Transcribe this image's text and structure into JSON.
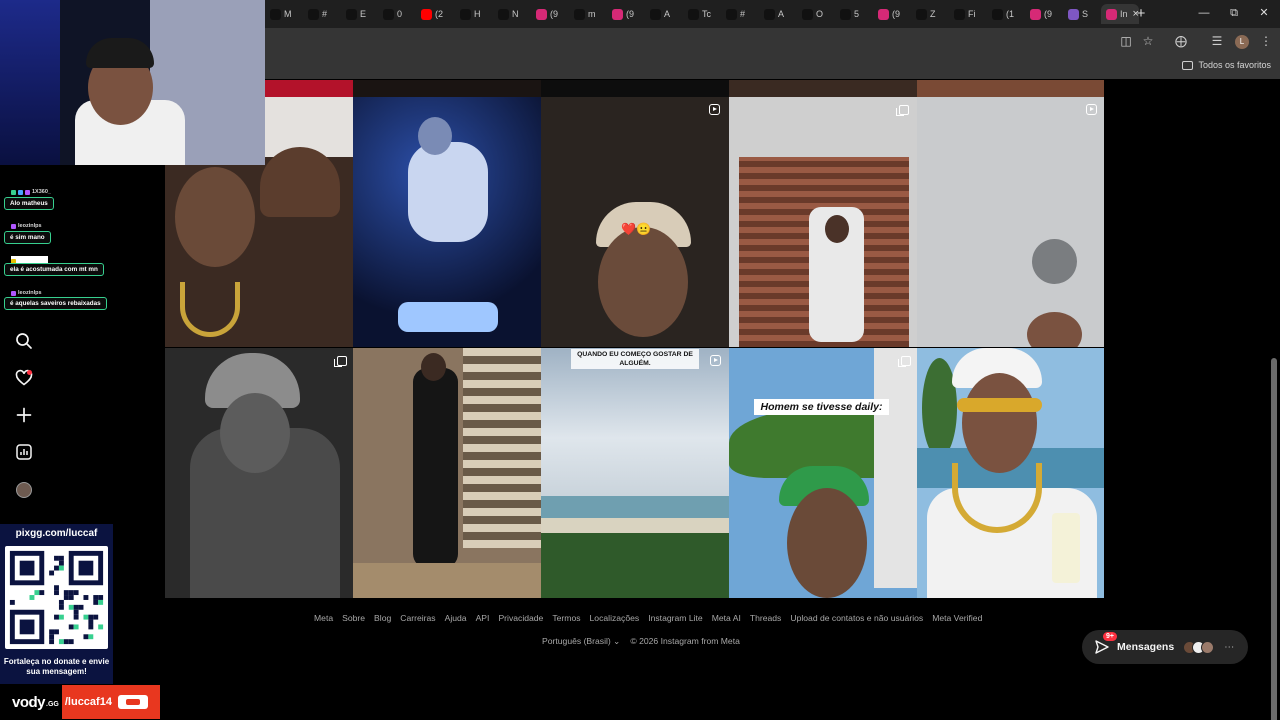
{
  "tabs": [
    {
      "label": "M",
      "icon": "tiktok-icon",
      "color": "#111111"
    },
    {
      "label": "#",
      "icon": "tiktok-icon",
      "color": "#111111"
    },
    {
      "label": "E",
      "icon": "tiktok-icon",
      "color": "#111111"
    },
    {
      "label": "0",
      "icon": "tiktok-icon",
      "color": "#111111"
    },
    {
      "label": "(2",
      "icon": "youtube-icon",
      "color": "#ff0000"
    },
    {
      "label": "H",
      "icon": "tiktok-icon",
      "color": "#111111"
    },
    {
      "label": "N",
      "icon": "tiktok-icon",
      "color": "#111111"
    },
    {
      "label": "(9",
      "icon": "instagram-icon",
      "color": "#d62976"
    },
    {
      "label": "m",
      "icon": "tiktok-icon",
      "color": "#111111"
    },
    {
      "label": "(9",
      "icon": "instagram-icon",
      "color": "#d62976"
    },
    {
      "label": "A",
      "icon": "tiktok-icon",
      "color": "#111111"
    },
    {
      "label": "Tc",
      "icon": "tiktok-icon",
      "color": "#111111"
    },
    {
      "label": "#",
      "icon": "tiktok-icon",
      "color": "#111111"
    },
    {
      "label": "A",
      "icon": "tiktok-icon",
      "color": "#111111"
    },
    {
      "label": "O",
      "icon": "tiktok-icon",
      "color": "#111111"
    },
    {
      "label": "5",
      "icon": "tiktok-icon",
      "color": "#111111"
    },
    {
      "label": "(9",
      "icon": "instagram-icon",
      "color": "#d62976"
    },
    {
      "label": "Z",
      "icon": "tiktok-icon",
      "color": "#111111"
    },
    {
      "label": "Fi",
      "icon": "tiktok-icon",
      "color": "#111111"
    },
    {
      "label": "(1",
      "icon": "x-icon",
      "color": "#111111"
    },
    {
      "label": "(9",
      "icon": "instagram-icon",
      "color": "#d62976"
    },
    {
      "label": "S",
      "icon": "feather-icon",
      "color": "#7e57c2"
    },
    {
      "label": "In",
      "icon": "instagram-icon",
      "color": "#d62976",
      "active": true
    }
  ],
  "bookmarks": {
    "folder_label": "Todos os favoritos"
  },
  "grid": {
    "row2": [
      {
        "name": "post-heart-hands",
        "icon": "none"
      },
      {
        "name": "post-club-night",
        "icon": "none"
      },
      {
        "name": "post-selfie-cap",
        "icon": "reel"
      },
      {
        "name": "post-mirror-shop",
        "icon": "multi"
      },
      {
        "name": "post-wall-closeup",
        "icon": "reel"
      }
    ],
    "row3": [
      {
        "name": "post-bw-cap",
        "icon": "multi"
      },
      {
        "name": "post-sneaker-store",
        "icon": "none"
      },
      {
        "name": "post-beach-sky",
        "icon": "reel",
        "caption": "QUANDO EU COMEÇO GOSTAR DE ALGUÉM."
      },
      {
        "name": "post-palm-green-cap",
        "icon": "multi",
        "caption": "Homem se tivesse daily:"
      },
      {
        "name": "post-gold-chain-drink",
        "icon": "none"
      }
    ]
  },
  "footer": {
    "links": [
      "Meta",
      "Sobre",
      "Blog",
      "Carreiras",
      "Ajuda",
      "API",
      "Privacidade",
      "Termos",
      "Localizações",
      "Instagram Lite",
      "Meta AI",
      "Threads",
      "Upload de contatos e não usuários",
      "Meta Verified"
    ],
    "language": "Português (Brasil)",
    "copyright": "© 2026 Instagram from Meta"
  },
  "messages": {
    "label": "Mensagens",
    "badge": "9+"
  },
  "chat": [
    {
      "user": "1X360_",
      "text": "Alo matheus"
    },
    {
      "user": "leozinlps",
      "text": "é sim mano"
    },
    {
      "user": "",
      "text": "ela é acostumada com mt mn"
    },
    {
      "user": "leozinlps",
      "text": "é aquelas saveiros rebaixadas"
    }
  ],
  "overlay": {
    "pix_title": "pixgg.com/luccaf",
    "pix_message": "Fortaleça no donate e envie sua mensagem!",
    "vody_logo": "vody",
    "vody_gg": ".GG",
    "vody_handle": "/luccaf14"
  },
  "colors": {
    "instagram_bg": "#000000",
    "chat_border": "#37d08f",
    "notification": "#ff3040",
    "vody_accent": "#e8371f"
  }
}
